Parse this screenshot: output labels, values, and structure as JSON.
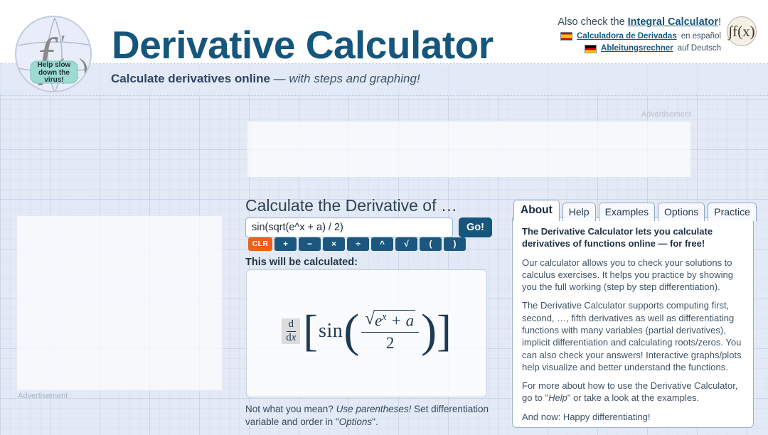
{
  "header": {
    "title": "Derivative Calculator",
    "subtitle_bold": "Calculate derivatives online",
    "subtitle_dash": " — ",
    "subtitle_italic": "with steps and graphing!",
    "logo": {
      "symbol": "f'(x)",
      "sticker_line1": "Help slow",
      "sticker_line2": "down the",
      "sticker_line3": "virus!"
    },
    "integral_logo_label": "∫f(x)",
    "also_check_prefix": "Also check the ",
    "also_check_link": "Integral Calculator",
    "also_check_suffix": "!",
    "languages": [
      {
        "flag": "spain-flag",
        "link": "Calculadora de Derivadas",
        "suffix": " en español"
      },
      {
        "flag": "germany-flag",
        "link": "Ableitungsrechner",
        "suffix": " auf Deutsch"
      }
    ]
  },
  "ads": {
    "top_label": "Advertisement",
    "left_label": "Advertisement"
  },
  "calculator": {
    "heading": "Calculate the Derivative of …",
    "expression_value": "sin(sqrt(e^x + a) / 2)",
    "expression_placeholder": "",
    "go_label": "Go!",
    "operator_buttons": [
      {
        "name": "clear",
        "label": "CLR",
        "color": "#e8631a"
      },
      {
        "name": "plus",
        "label": "+",
        "color": "#1c5780"
      },
      {
        "name": "minus",
        "label": "−",
        "color": "#1c5780"
      },
      {
        "name": "times",
        "label": "×",
        "color": "#1c5780"
      },
      {
        "name": "divide",
        "label": "÷",
        "color": "#1c5780"
      },
      {
        "name": "power",
        "label": "^",
        "color": "#1c5780"
      },
      {
        "name": "sqrt",
        "label": "√",
        "color": "#1c5780"
      },
      {
        "name": "paren-open",
        "label": "(",
        "color": "#1c5780"
      },
      {
        "name": "paren-close",
        "label": ")",
        "color": "#1c5780"
      }
    ],
    "will_be_calculated_label": "This will be calculated:",
    "formula": {
      "operator_num": "d",
      "operator_den_d": "d",
      "operator_den_var": "x",
      "bracket_open": "[",
      "function_name": "sin",
      "paren_open": "(",
      "numerator_radicand_base": "e",
      "numerator_radicand_exp": "x",
      "numerator_radicand_rest": " + a",
      "denominator": "2",
      "paren_close": ")",
      "bracket_close": "]",
      "plain": "d/dx [ sin( sqrt(e^x + a) / 2 ) ]"
    },
    "hint_q": "Not what you mean? ",
    "hint_em": "Use parentheses!",
    "hint_rest": " Set differentiation variable and order in \"",
    "hint_em2": "Options",
    "hint_tail": "\"."
  },
  "tabs": [
    {
      "label": "About",
      "active": true
    },
    {
      "label": "Help",
      "active": false
    },
    {
      "label": "Examples",
      "active": false
    },
    {
      "label": "Options",
      "active": false
    },
    {
      "label": "Practice",
      "active": false
    }
  ],
  "about_panel": {
    "p1": "The Derivative Calculator lets you calculate derivatives of functions online — for free!",
    "p2": "Our calculator allows you to check your solutions to calculus exercises. It helps you practice by showing you the full working (step by step differentiation).",
    "p3": "The Derivative Calculator supports computing first, second, …, fifth derivatives as well as differentiating functions with many variables (partial derivatives), implicit differentiation and calculating roots/zeros. You can also check your answers! Interactive graphs/plots help visualize and better understand the functions.",
    "p4_a": "For more about how to use the Derivative Calculator, go to \"",
    "p4_em": "Help",
    "p4_b": "\" or take a look at the examples.",
    "p5": "And now: Happy differentiating!"
  },
  "colors": {
    "brand_blue": "#15567d",
    "accent_orange": "#e8631a",
    "page_bg": "#e3eaf6",
    "text_dark": "#2f3b47"
  }
}
